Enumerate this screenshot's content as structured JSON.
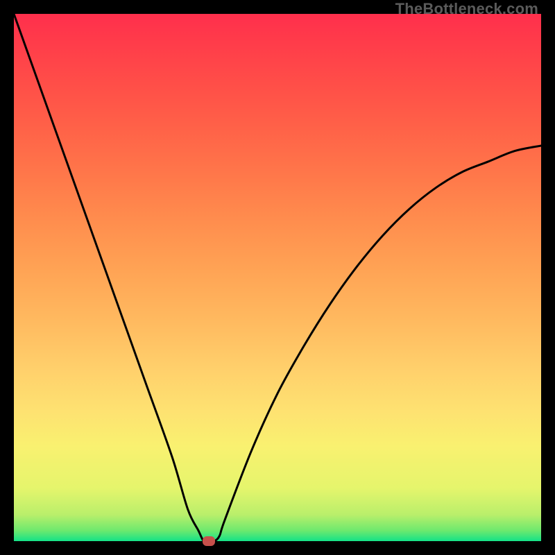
{
  "watermark": {
    "text": "TheBottleneck.com"
  },
  "chart_data": {
    "type": "line",
    "title": "",
    "xlabel": "",
    "ylabel": "",
    "xlim": [
      0,
      100
    ],
    "ylim": [
      0,
      100
    ],
    "grid": false,
    "legend": false,
    "background": "rainbow-vertical-gradient",
    "series": [
      {
        "name": "bottleneck-curve",
        "x": [
          0,
          5,
          10,
          15,
          20,
          25,
          30,
          33,
          35,
          36,
          37,
          38,
          39,
          40,
          45,
          50,
          55,
          60,
          65,
          70,
          75,
          80,
          85,
          90,
          95,
          100
        ],
        "values": [
          100,
          86,
          72,
          58,
          44,
          30,
          16,
          6,
          2,
          0,
          0,
          0,
          1,
          4,
          17,
          28,
          37,
          45,
          52,
          58,
          63,
          67,
          70,
          72,
          74,
          75
        ]
      }
    ],
    "minimum_marker": {
      "x": 37,
      "y": 0,
      "color": "#c6504b"
    }
  }
}
